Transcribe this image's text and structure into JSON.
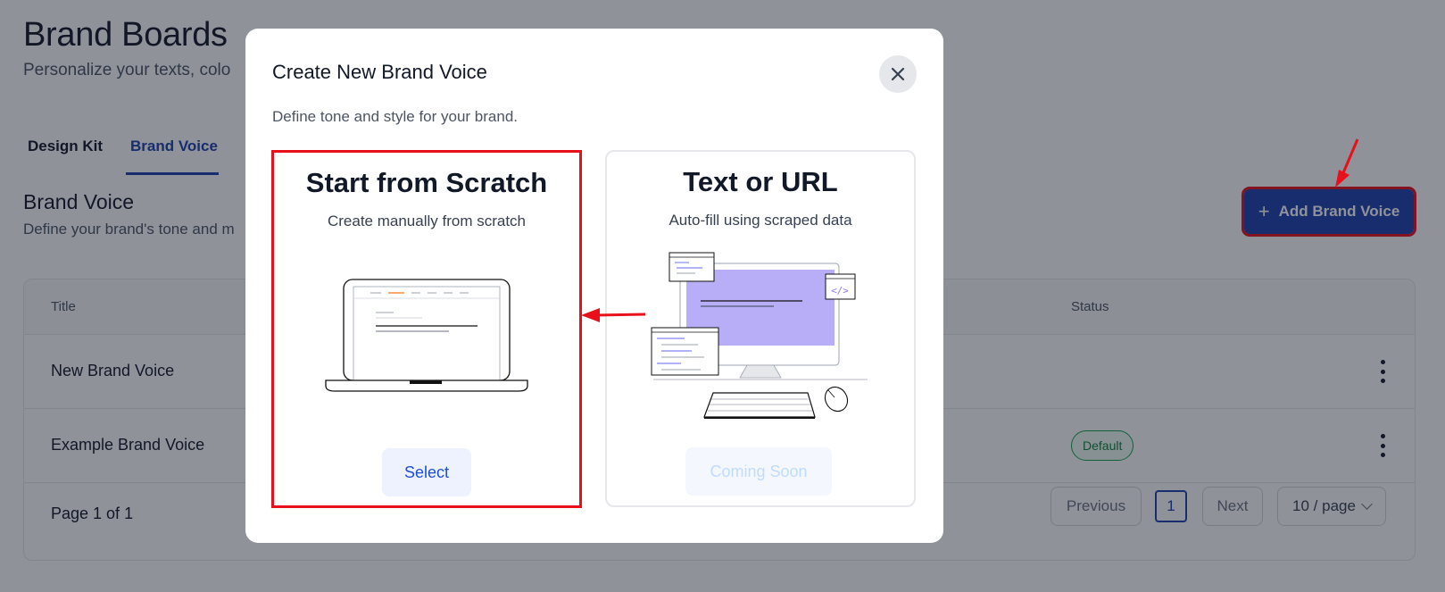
{
  "page": {
    "title": "Brand Boards",
    "subtitle": "Personalize your texts, colo"
  },
  "tabs": [
    {
      "label": "Design Kit",
      "active": false
    },
    {
      "label": "Brand Voice",
      "active": true
    }
  ],
  "section": {
    "title": "Brand Voice",
    "description": "Define your brand's tone and m"
  },
  "add_button": {
    "icon": "plus-icon",
    "label": "Add Brand Voice"
  },
  "table": {
    "columns": [
      "Title",
      "Status"
    ],
    "rows": [
      {
        "title": "New Brand Voice",
        "status": ""
      },
      {
        "title": "Example Brand Voice",
        "status": "Default"
      }
    ]
  },
  "pagination": {
    "summary": "Page 1 of 1",
    "previous": "Previous",
    "current": "1",
    "next": "Next",
    "page_size": "10 / page"
  },
  "modal": {
    "title": "Create New Brand Voice",
    "description": "Define tone and style for your brand.",
    "options": [
      {
        "heading": "Start from Scratch",
        "subtitle": "Create manually from scratch",
        "action": "Select",
        "illustration": "laptop-illustration"
      },
      {
        "heading": "Text or URL",
        "subtitle": "Auto-fill using scraped data",
        "action": "Coming Soon",
        "illustration": "desktop-code-illustration"
      }
    ]
  },
  "colors": {
    "primary": "#1e40af",
    "annotation_red": "#e8101a",
    "badge_green": "#16a34a",
    "illustration_purple": "#b8aef8"
  }
}
